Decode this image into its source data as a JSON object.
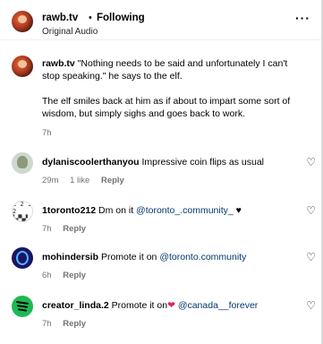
{
  "header": {
    "username": "rawb.tv",
    "separator": "•",
    "following_label": "Following",
    "audio": "Original Audio",
    "more_icon": "more-horizontal-icon",
    "more_glyph": "···"
  },
  "caption": {
    "username": "rawb.tv",
    "line1": "\"Nothing needs to be said and unfortunately I can't stop speaking.\" he says to the elf.",
    "line2": "The elf smiles back at him as if about to impart some sort of wisdom, but simply sighs and goes back to work.",
    "time": "7h"
  },
  "comments": [
    {
      "username": "dylaniscoolerthanyou",
      "text": "Impressive coin flips as usual",
      "time": "29m",
      "likes": "1 like",
      "reply": "Reply"
    },
    {
      "username": "1toronto212",
      "text_before": "Dm on it",
      "mention": "@toronto_.community_",
      "text_after": "♥",
      "time": "7h",
      "reply": "Reply",
      "avatar_text": "1 2 1 2\n▚▞▚▞"
    },
    {
      "username": "mohindersib",
      "text_before": "Promote it on",
      "mention": "@toronto.community",
      "time": "6h",
      "reply": "Reply"
    },
    {
      "username": "creator_linda.2",
      "text_before": "Promote it on",
      "heart": "❤",
      "mention": "@canada__forever",
      "time": "7h",
      "reply": "Reply"
    }
  ],
  "heart_glyph": "♡"
}
